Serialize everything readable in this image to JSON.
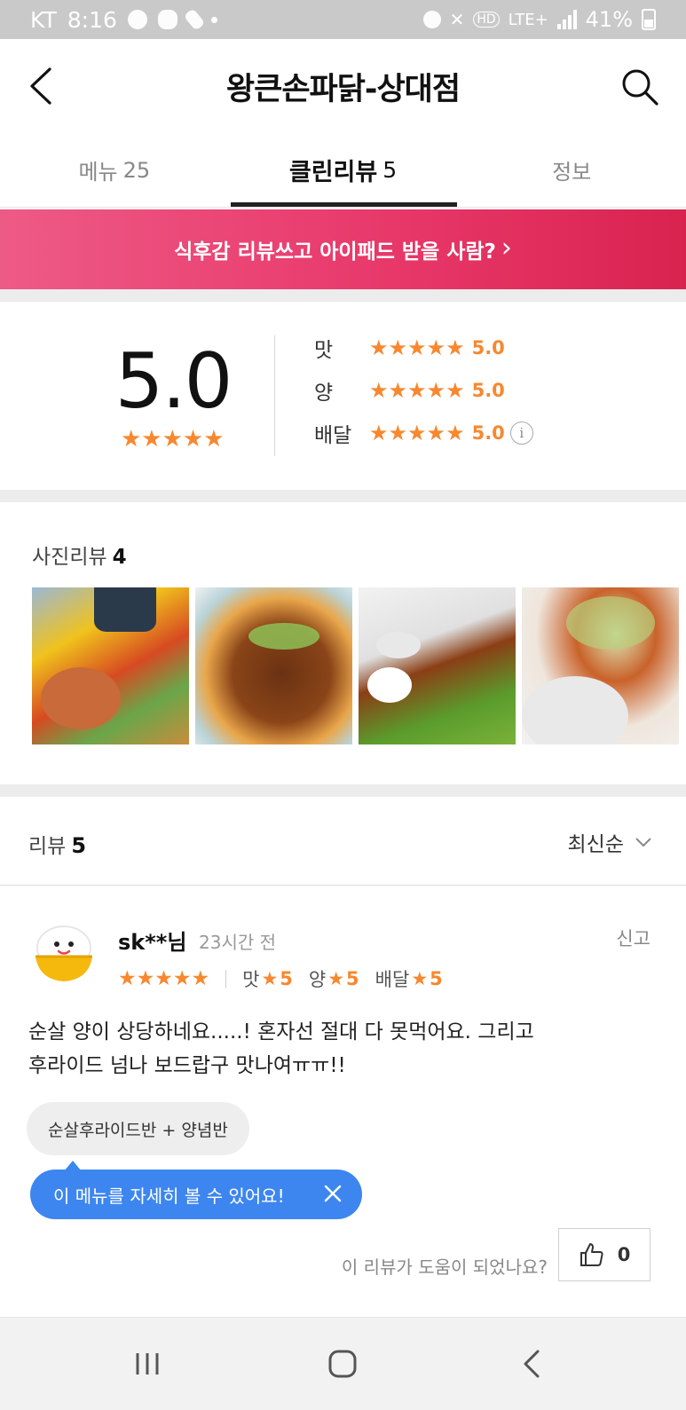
{
  "status_bar": {
    "carrier": "KT",
    "time": "8:16",
    "network": "LTE+",
    "battery": "41%"
  },
  "header": {
    "title": "왕큰손파닭-상대점"
  },
  "tabs": [
    {
      "label": "메뉴",
      "count": "25"
    },
    {
      "label": "클린리뷰",
      "count": "5"
    },
    {
      "label": "정보",
      "count": ""
    }
  ],
  "banner": {
    "text": "식후감 리뷰쓰고 아이패드 받을 사람?",
    "arrow": "›"
  },
  "rating": {
    "overall": "5.0",
    "overall_stars": "★★★★★",
    "items": [
      {
        "label": "맛",
        "stars": "★★★★★",
        "value": "5.0"
      },
      {
        "label": "양",
        "stars": "★★★★★",
        "value": "5.0"
      },
      {
        "label": "배달",
        "stars": "★★★★★",
        "value": "5.0"
      }
    ],
    "info_icon": "i"
  },
  "photo_reviews": {
    "label": "사진리뷰",
    "count": "4"
  },
  "reviews": {
    "label": "리뷰",
    "count": "5",
    "sort": "최신순"
  },
  "review": {
    "name": "sk**님",
    "time": "23시간 전",
    "report": "신고",
    "stars": "★★★★★",
    "scores": [
      {
        "label": "맛",
        "star": "★",
        "value": "5"
      },
      {
        "label": "양",
        "star": "★",
        "value": "5"
      },
      {
        "label": "배달",
        "star": "★",
        "value": "5"
      }
    ],
    "text_line1": "순살 양이 상당하네요.....! 혼자선 절대 다 못먹어요. 그리고",
    "text_line2": "후라이드 넘나 보드랍구 맛나여ㅠㅠ!!",
    "menu_chip": "순살후라이드반 + 양념반",
    "tooltip": "이 메뉴를 자세히 볼 수 있어요!",
    "helpful_question": "이 리뷰가 도움이 되었나요?",
    "like_count": "0"
  },
  "colors": {
    "accent_orange": "#f7882f",
    "banner_pink": "#e8396b",
    "tooltip_blue": "#3d86f0"
  }
}
